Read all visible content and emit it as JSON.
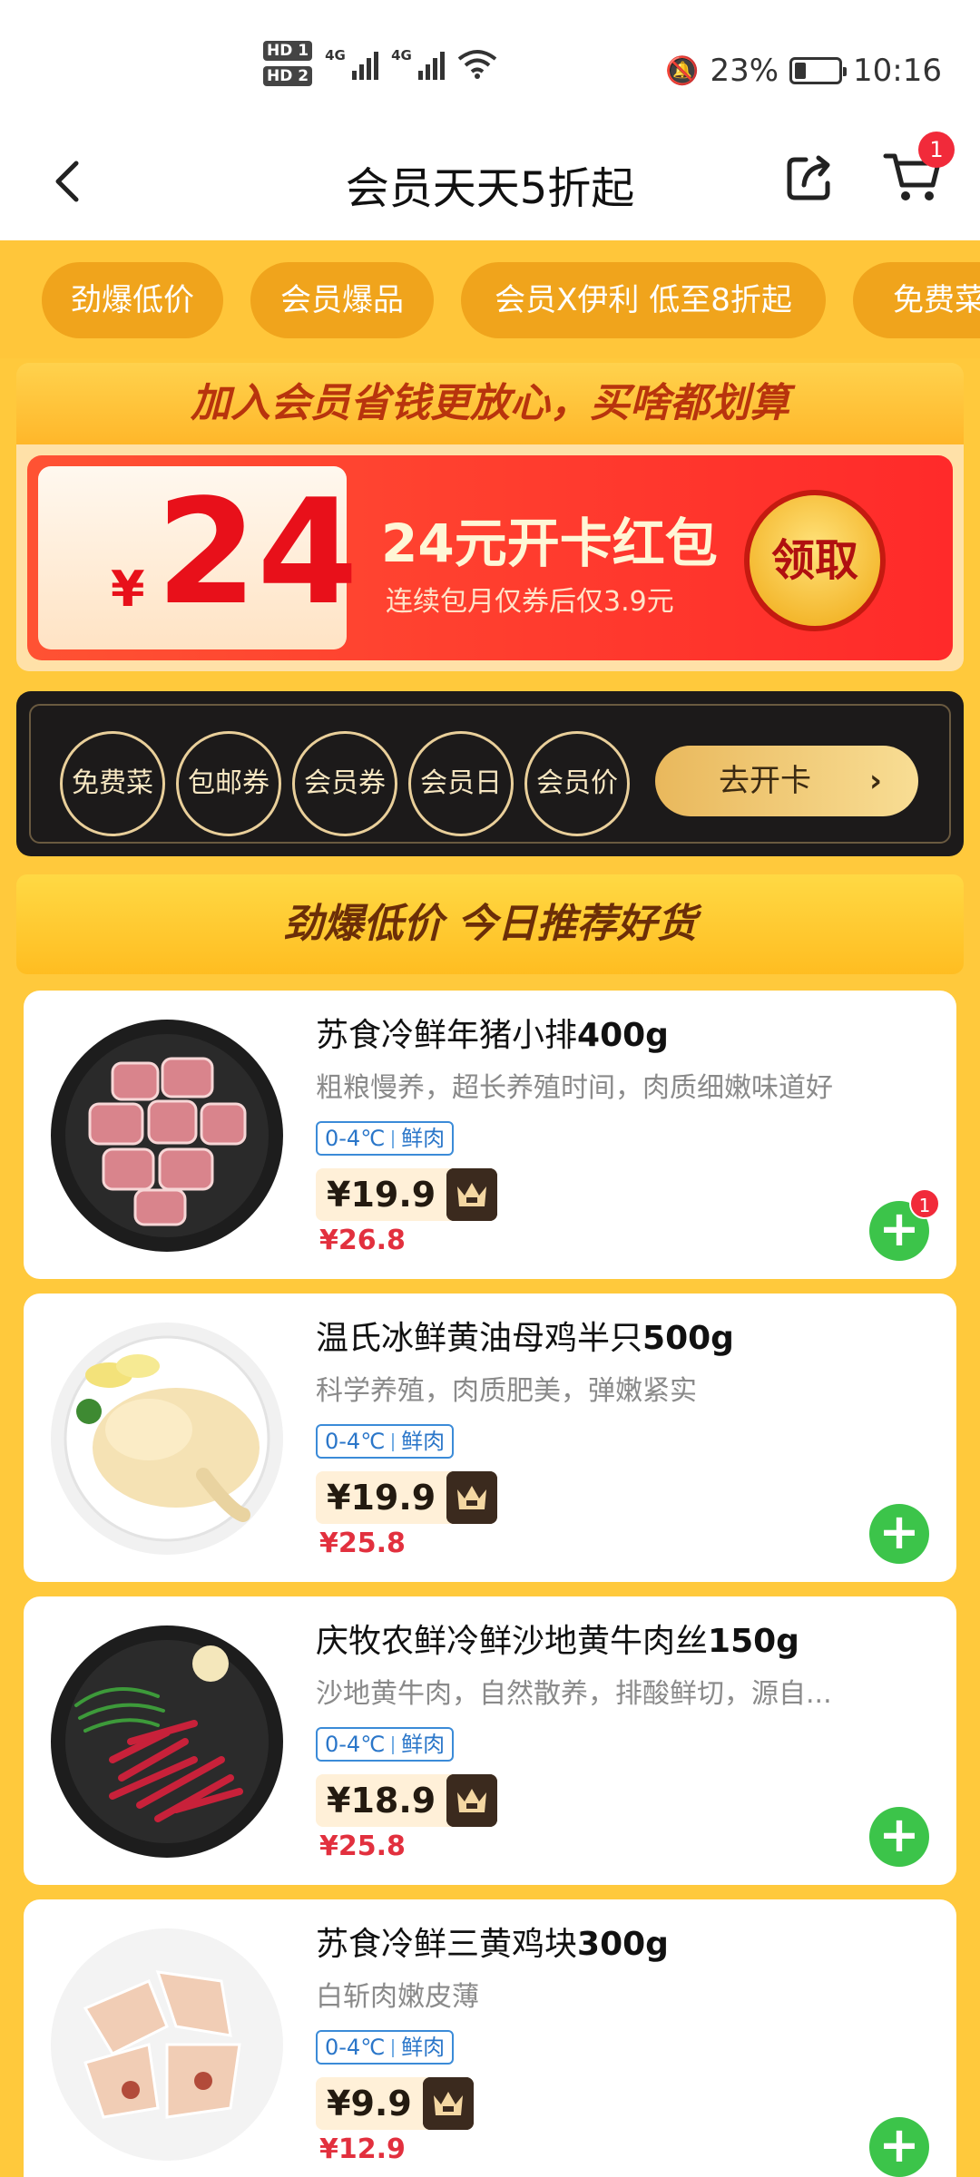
{
  "status_bar": {
    "hd1": "HD 1",
    "hd2": "HD 2",
    "net1": "4G",
    "net2": "4G",
    "battery": "23%",
    "time": "10:16"
  },
  "header": {
    "title": "会员天天5折起",
    "cart_count": "1"
  },
  "tabs": [
    "劲爆低价",
    "会员爆品",
    "会员X伊利 低至8折起",
    "免费菜"
  ],
  "member_banner": {
    "headline": "加入会员省钱更放心，买啥都划算",
    "coupon_currency": "¥",
    "coupon_amount": "24",
    "coupon_title": "24元开卡红包",
    "coupon_subtitle": "连续包月仅券后仅3.9元",
    "claim_label": "领取"
  },
  "benefits": {
    "items": [
      "免费菜",
      "包邮券",
      "会员券",
      "会员日",
      "会员价"
    ],
    "open_card_label": "去开卡",
    "open_card_arrow": "›"
  },
  "recommend_banner": "劲爆低价  今日推荐好货",
  "products": [
    {
      "name": "苏食冷鲜年猪小排",
      "weight": "400g",
      "desc": "粗粮慢养，超长养殖时间，肉质细嫩味道好",
      "tag_temp": "0-4℃",
      "tag_type": "鲜肉",
      "price": "¥19.9",
      "old_price": "¥26.8",
      "in_cart": "1"
    },
    {
      "name": "温氏冰鲜黄油母鸡半只",
      "weight": "500g",
      "desc": "科学养殖，肉质肥美，弹嫩紧实",
      "tag_temp": "0-4℃",
      "tag_type": "鲜肉",
      "price": "¥19.9",
      "old_price": "¥25.8"
    },
    {
      "name": "庆牧农鲜冷鲜沙地黄牛肉丝",
      "weight": "150g",
      "desc": "沙地黄牛肉，自然散养，排酸鲜切，源自...",
      "tag_temp": "0-4℃",
      "tag_type": "鲜肉",
      "price": "¥18.9",
      "old_price": "¥25.8"
    },
    {
      "name": "苏食冷鲜三黄鸡块",
      "weight": "300g",
      "desc": "白斩肉嫩皮薄",
      "tag_temp": "0-4℃",
      "tag_type": "鲜肉",
      "price": "¥9.9",
      "old_price": "¥12.9"
    }
  ],
  "icons": {
    "back": "chevron-left-icon",
    "share": "share-icon",
    "cart": "cart-icon",
    "add": "plus-icon",
    "vip": "crown-icon"
  },
  "colors": {
    "page_bg": "#ffc93c",
    "tab_bg": "#f0a41c",
    "price_red": "#e2303e",
    "add_green": "#3cc44a",
    "badge_red": "#f12a3a"
  }
}
